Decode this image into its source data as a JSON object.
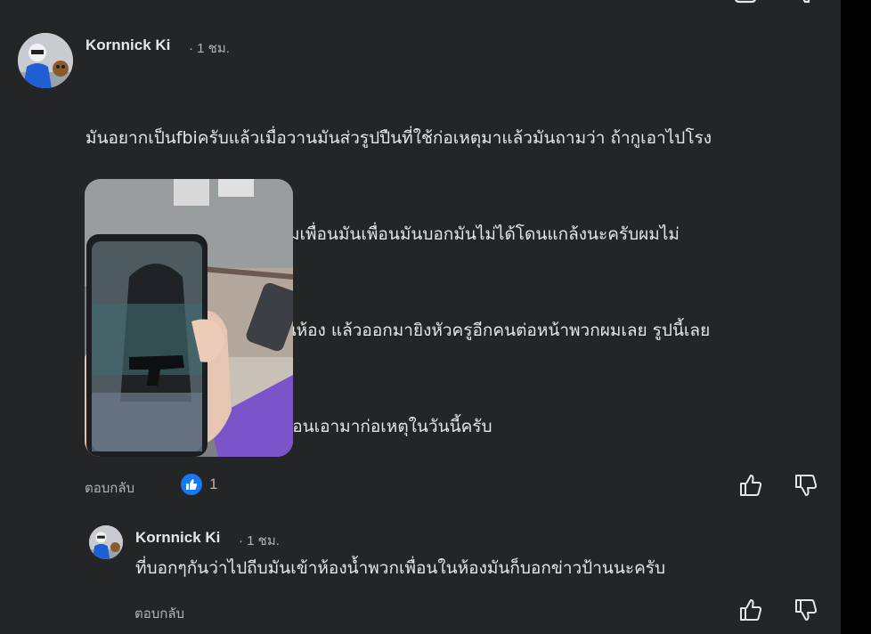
{
  "comments": [
    {
      "author": "Kornnick Ki",
      "time": "· 1 ชม.",
      "lines": [
        "มันอยากเป็นfbiครับแล้วเมื่อวานมันส่วรูปปืนที่ใช้ก่อเหตุมาแล้วมันถามว่า ถ้ากูเอาไปโรง",
        "เรียนจะเป็นยังไง แต่เท่าที่ถามเพื่อนมันเพื่อนมันบอกมันไม่ได้โดนแกล้งนะครับผมไม่",
        "แน่ใจแต่ที่แน่ๆมันยิงครูผญในห้อง แล้วออกมายิงหัวครูอีกคนต่อหน้าพวกผมเลย รูปนี้เลย",
        "ครับที่มันส่งมาถามเพื่อนมันก่อนเอามาก่อเหตุในวันนี้ครับ"
      ],
      "reply_label": "ตอบกลับ",
      "reaction_count": "1"
    },
    {
      "author": "Kornnick Ki",
      "time": "· 1 ชม.",
      "text": "ที่บอกๆกันว่าไปถีบมันเข้าห้องน้ำพวกเพื่อนในห้องมันก็บอกข่าวป้านนะครับ",
      "reply_label": "ตอบกลับ"
    }
  ],
  "icons": {
    "like": "thumbs-up-icon",
    "dislike": "thumbs-down-icon",
    "reaction": "like-reaction-icon"
  },
  "colors": {
    "panel_bg": "#242526",
    "text": "#e4e6eb",
    "secondary": "#b0b3b8",
    "accent": "#1877f2"
  }
}
